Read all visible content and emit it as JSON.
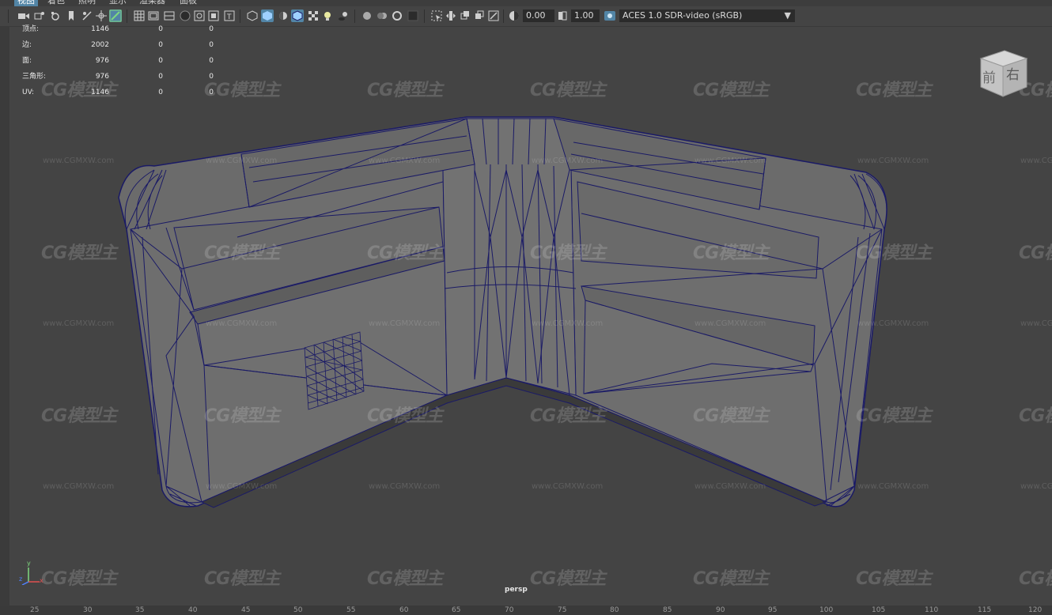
{
  "menu": [
    "视图",
    "着色",
    "照明",
    "显示",
    "渲染器",
    "面板"
  ],
  "toolbar": {
    "exposure_value": "0.00",
    "gamma_value": "1.00",
    "color_space": "ACES 1.0 SDR-video (sRGB)"
  },
  "hud": {
    "rows": [
      {
        "label": "顶点:",
        "v1": "1146",
        "v2": "0",
        "v3": "0"
      },
      {
        "label": "边:",
        "v1": "2002",
        "v2": "0",
        "v3": "0"
      },
      {
        "label": "面:",
        "v1": "976",
        "v2": "0",
        "v3": "0"
      },
      {
        "label": "三角形:",
        "v1": "976",
        "v2": "0",
        "v3": "0"
      },
      {
        "label": "UV:",
        "v1": "1146",
        "v2": "0",
        "v3": "0"
      }
    ]
  },
  "viewcube": {
    "front": "前",
    "right": "右"
  },
  "camera_label": "persp",
  "axis": {
    "x": "x",
    "y": "y",
    "z": "z"
  },
  "watermark": {
    "logo": "CG模型主",
    "url": "www.CGMXW.com"
  },
  "ruler_ticks": [
    "25",
    "30",
    "35",
    "40",
    "45",
    "50",
    "55",
    "60",
    "65",
    "70",
    "75",
    "80",
    "85",
    "90",
    "95",
    "100",
    "105",
    "110",
    "115",
    "120"
  ],
  "colors": {
    "viewport_bg": "#444444",
    "wireframe": "#1a1a66",
    "mesh_fill": "#6a6a6a",
    "accent": "#5285a6"
  }
}
